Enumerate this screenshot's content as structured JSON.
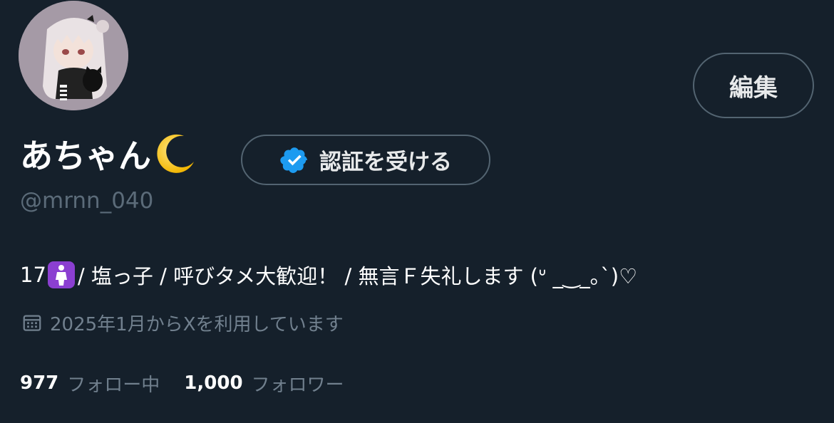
{
  "profile": {
    "display_name": "あちゃん",
    "display_name_emoji": "crescent-moon-icon",
    "handle": "@mrnn_040",
    "bio_prefix": "17",
    "bio_emoji": "standing-person-icon",
    "bio_rest": " / 塩っ子 / 呼びタメ大歓迎！ / 無言Ｆ失礼します (ᐡ _‿_｡`)♡",
    "joined": "2025年1月からXを利用しています"
  },
  "buttons": {
    "edit_label": "編集",
    "verify_label": "認証を受ける"
  },
  "stats": {
    "following_count": "977",
    "following_label": "フォロー中",
    "followers_count": "1,000",
    "followers_label": "フォロワー"
  },
  "colors": {
    "background": "#15202b",
    "verified_badge": "#1d9bf0",
    "secondary_text": "#71808e",
    "border": "#536471"
  }
}
